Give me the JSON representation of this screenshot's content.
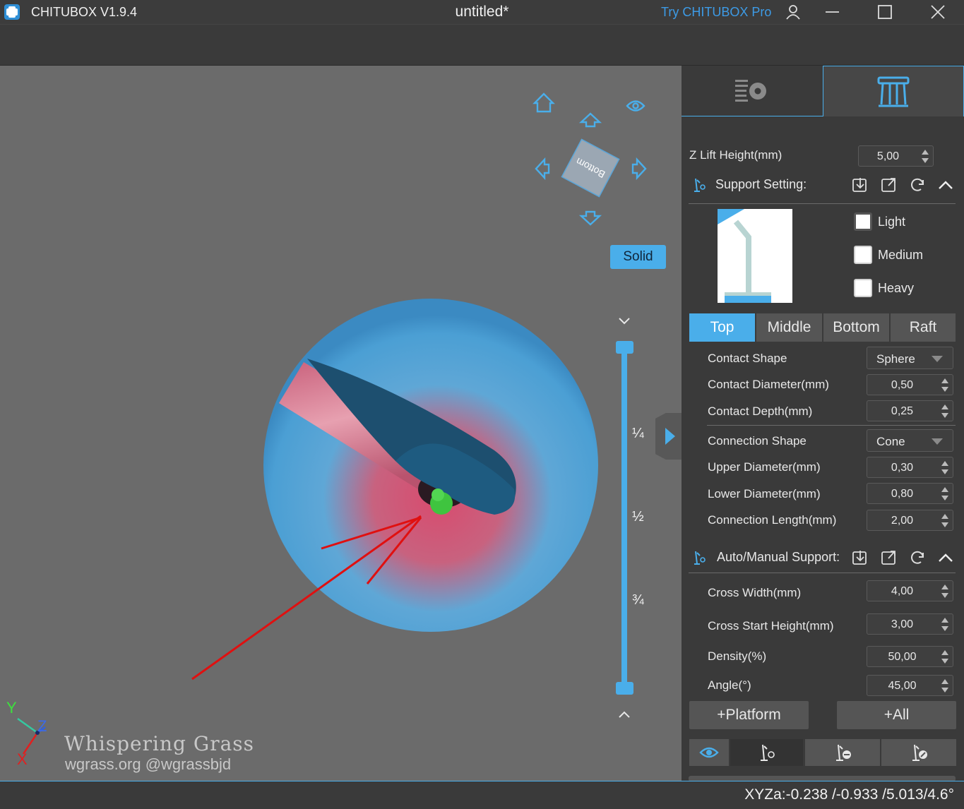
{
  "titlebar": {
    "app_name": "CHITUBOX V1.9.4",
    "document_title": "untitled*",
    "try_pro": "Try CHITUBOX Pro",
    "icons": [
      "app-logo",
      "user-icon",
      "minimize-icon",
      "maximize-icon",
      "close-icon"
    ]
  },
  "viewport": {
    "view_cube_face": "Bottom",
    "render_mode": "Solid",
    "slider_fractions": [
      "¼",
      "½",
      "¾"
    ],
    "axis_labels": {
      "y": "Y",
      "z": "Z",
      "x": "X"
    },
    "watermark_title": "Whispering Grass",
    "watermark_url": "wgrass.org @wgrassbjd",
    "colors": {
      "background": "#6b6b6b",
      "model": "#4aa3d8",
      "accent": "#4aaeea",
      "annotation": "#e01010",
      "selected_point": "#3fc43f"
    }
  },
  "panel": {
    "tabs": [
      "settings-gear-icon",
      "support-columns-icon"
    ],
    "z_lift": {
      "label": "Z Lift Height(mm)",
      "value": "5,00"
    },
    "support_setting": {
      "title": "Support Setting:",
      "presets": [
        {
          "label": "Light",
          "checked": true
        },
        {
          "label": "Medium",
          "checked": false
        },
        {
          "label": "Heavy",
          "checked": false
        }
      ]
    },
    "segment_tabs": [
      "Top",
      "Middle",
      "Bottom",
      "Raft"
    ],
    "active_segment": "Top",
    "fields": {
      "contact_shape": {
        "label": "Contact Shape",
        "value": "Sphere"
      },
      "contact_diameter": {
        "label": "Contact Diameter(mm)",
        "value": "0,50"
      },
      "contact_depth": {
        "label": "Contact Depth(mm)",
        "value": "0,25"
      },
      "connection_shape": {
        "label": "Connection Shape",
        "value": "Cone"
      },
      "upper_diameter": {
        "label": "Upper Diameter(mm)",
        "value": "0,30"
      },
      "lower_diameter": {
        "label": "Lower Diameter(mm)",
        "value": "0,80"
      },
      "connection_length": {
        "label": "Connection Length(mm)",
        "value": "2,00"
      }
    },
    "auto_manual": {
      "title": "Auto/Manual Support:",
      "cross_width": {
        "label": "Cross Width(mm)",
        "value": "4,00"
      },
      "cross_start_height": {
        "label": "Cross Start Height(mm)",
        "value": "3,00"
      },
      "density": {
        "label": "Density(%)",
        "value": "50,00"
      },
      "angle": {
        "label": "Angle(°)",
        "value": "45,00"
      }
    },
    "buttons": {
      "platform": "+Platform",
      "all": "+All"
    },
    "tool_icons": [
      "eye-icon",
      "add-support-icon",
      "remove-support-icon",
      "clear-support-icon"
    ]
  },
  "status": {
    "coordinates": "XYZa:-0.238 /-0.933 /5.013/4.6°"
  }
}
